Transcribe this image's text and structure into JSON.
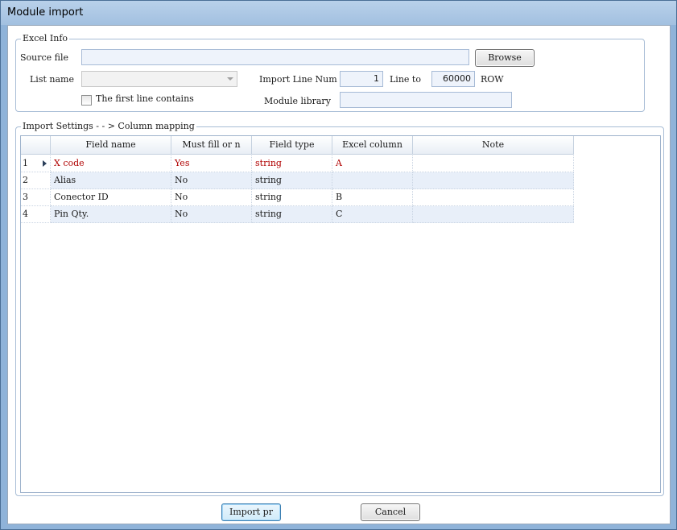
{
  "window": {
    "title": "Module import"
  },
  "excel_info": {
    "legend": "Excel Info",
    "source_file_label": "Source file",
    "source_file_value": "",
    "browse_label": "Browse",
    "list_name_label": "List name",
    "list_name_value": "",
    "import_line_num_label": "Import Line Num",
    "import_line_num_value": "1",
    "line_to_label": "Line to",
    "line_to_value": "60000",
    "row_unit": "ROW",
    "first_line_label": "The first line contains",
    "module_library_label": "Module library",
    "module_library_value": ""
  },
  "import_settings": {
    "legend": "Import Settings - - > Column mapping",
    "columns": [
      "Field name",
      "Must fill or n",
      "Field type",
      "Excel column",
      "Note"
    ],
    "rows": [
      {
        "num": "1",
        "field": "X code",
        "must": "Yes",
        "type": "string",
        "excel": "A",
        "note": ""
      },
      {
        "num": "2",
        "field": "Alias",
        "must": "No",
        "type": "string",
        "excel": "",
        "note": ""
      },
      {
        "num": "3",
        "field": "Conector ID",
        "must": "No",
        "type": "string",
        "excel": "B",
        "note": ""
      },
      {
        "num": "4",
        "field": "Pin Qty.",
        "must": "No",
        "type": "string",
        "excel": "C",
        "note": ""
      }
    ]
  },
  "footer": {
    "import_label": "Import pr",
    "cancel_label": "Cancel"
  }
}
